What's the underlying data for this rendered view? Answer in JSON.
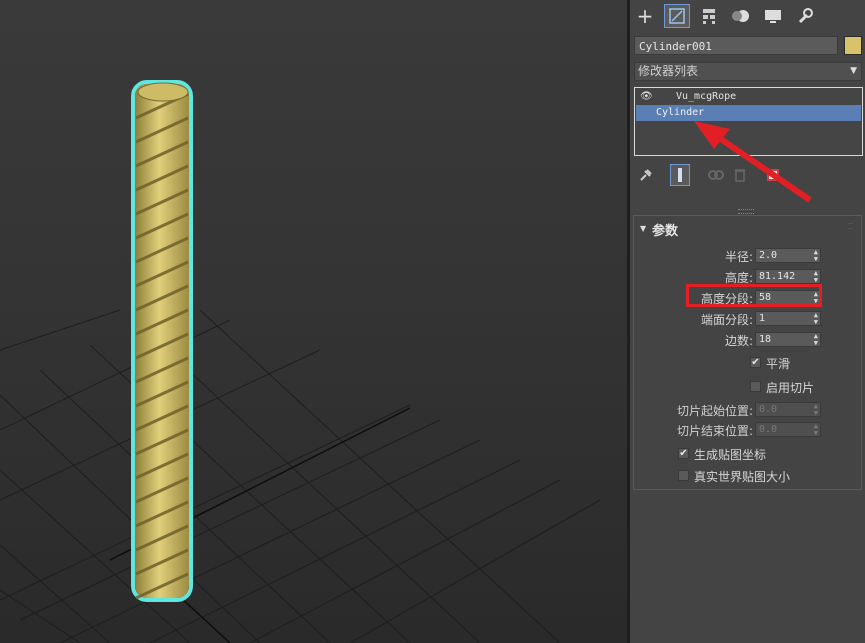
{
  "command_panel": {
    "tabs": [
      {
        "name": "create-tab",
        "icon": "plus-icon"
      },
      {
        "name": "modify-tab",
        "icon": "modify-icon",
        "active": true
      },
      {
        "name": "hierarchy-tab",
        "icon": "hierarchy-icon"
      },
      {
        "name": "motion-tab",
        "icon": "motion-icon"
      },
      {
        "name": "display-tab",
        "icon": "display-icon"
      },
      {
        "name": "utilities-tab",
        "icon": "wrench-icon"
      }
    ],
    "object_name": "Cylinder001",
    "object_color": "#d8c36a",
    "modifier_list_label": "修改器列表",
    "modifier_stack": [
      {
        "label": "Vu_mcgRope",
        "eye": true,
        "selected": false
      },
      {
        "label": "Cylinder",
        "selected": true
      }
    ],
    "stack_tools": [
      "pin-stack-icon",
      "show-end-result-icon",
      "make-unique-icon",
      "remove-modifier-icon",
      "configure-modifier-sets-icon"
    ]
  },
  "parameters": {
    "title": "参数",
    "fields": [
      {
        "label": "半径:",
        "value": "2.0"
      },
      {
        "label": "高度:",
        "value": "81.142"
      },
      {
        "label": "高度分段:",
        "value": "58"
      },
      {
        "label": "端面分段:",
        "value": "1"
      },
      {
        "label": "边数:",
        "value": "18"
      }
    ],
    "smooth": {
      "label": "平滑",
      "checked": true
    },
    "slice_on": {
      "label": "启用切片",
      "checked": false
    },
    "slice_from": {
      "label": "切片起始位置:",
      "value": "0.0"
    },
    "slice_to": {
      "label": "切片结束位置:",
      "value": "0.0"
    },
    "gen_mapping": {
      "label": "生成贴图坐标",
      "checked": true
    },
    "real_world": {
      "label": "真实世界贴图大小",
      "checked": false
    }
  },
  "annotation": {
    "highlight_color": "#e11f25"
  },
  "viewport": {
    "rope_color": "#d9c66e",
    "selection_color": "#5fe6e0"
  }
}
